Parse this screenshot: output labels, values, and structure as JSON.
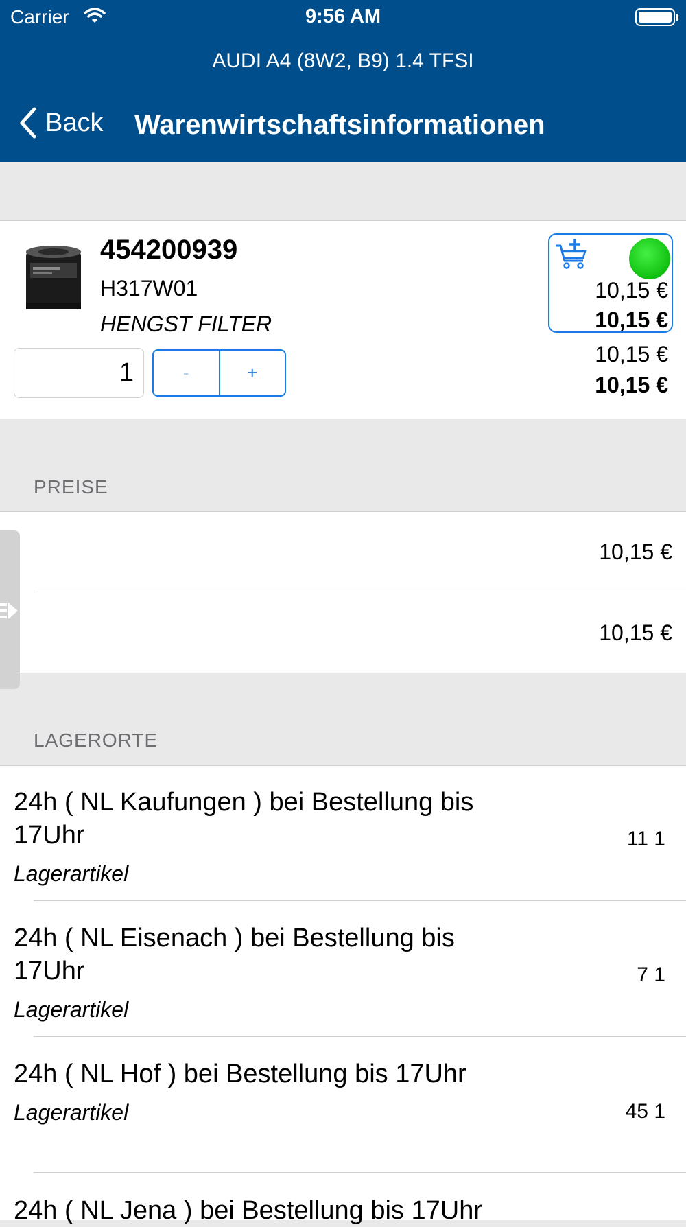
{
  "status_bar": {
    "carrier": "Carrier",
    "time": "9:56 AM"
  },
  "nav": {
    "vehicle": "AUDI A4 (8W2, B9) 1.4 TFSI",
    "back_label": "Back",
    "title": "Warenwirtschaftsinformationen"
  },
  "product": {
    "article_number": "454200939",
    "reference": "H317W01",
    "brand": "HENGST FILTER",
    "quantity": "1",
    "minus_label": "-",
    "plus_label": "+",
    "availability_color": "#10c010",
    "prices": [
      "10,15 €",
      "10,15 €",
      "10,15 €",
      "10,15 €"
    ]
  },
  "prices_section": {
    "header": "PREISE",
    "rows": [
      "10,15 €",
      "10,15 €"
    ]
  },
  "locations_section": {
    "header": "LAGERORTE",
    "items": [
      {
        "name": "24h ( NL Kaufungen ) bei Bestellung bis 17Uhr",
        "type": "Lagerartikel",
        "qty": "11 1"
      },
      {
        "name": "24h ( NL Eisenach ) bei Bestellung bis 17Uhr",
        "type": "Lagerartikel",
        "qty": "7 1"
      },
      {
        "name": "24h ( NL Hof ) bei Bestellung bis 17Uhr",
        "type": "Lagerartikel",
        "qty": "45 1"
      },
      {
        "name": "24h ( NL Jena ) bei Bestellung bis 17Uhr"
      }
    ]
  },
  "colors": {
    "nav_bar": "#004f8c",
    "accent": "#1a7be6",
    "background": "#e9e9e9"
  }
}
